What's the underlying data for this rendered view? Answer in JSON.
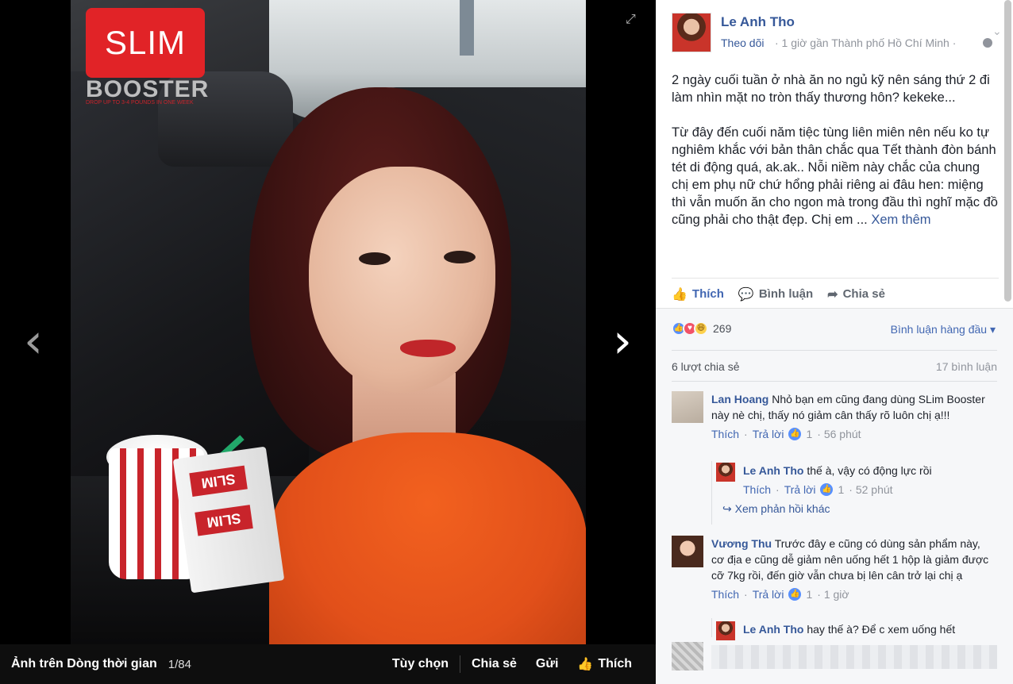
{
  "viewer": {
    "album_title": "Ảnh trên Dòng thời gian",
    "counter": "1/84",
    "options_label": "Tùy chọn",
    "share_label": "Chia sẻ",
    "send_label": "Gửi",
    "like_label": "Thích",
    "logo_text": "SLIM",
    "logo_sub": "BOOSTER",
    "logo_tagline": "DROP UP TO 3-4 POUNDS IN ONE WEEK"
  },
  "post": {
    "author": "Le Anh Tho",
    "follow": "Theo dõi",
    "meta": "· 1 giờ gần Thành phố Hồ Chí Minh ·",
    "paragraph1": "2 ngày cuối tuần ở nhà ăn no ngủ kỹ nên sáng thứ 2 đi làm nhìn mặt no tròn thấy thương hôn? kekeke...",
    "paragraph2": "Từ đây đến cuối năm tiệc tùng liên miên nên nếu ko tự nghiêm khắc với bản thân chắc qua Tết thành đòn bánh tét di động quá, ak.ak.. Nỗi niềm này chắc của chung chị em phụ nữ chứ hổng phải riêng ai đâu hen: miệng thì vẫn muốn ăn cho ngon mà trong đầu thì nghĩ mặc đồ cũng phải cho thật đẹp. Chị em ...",
    "see_more": "Xem thêm",
    "actions": {
      "like": "Thích",
      "comment": "Bình luận",
      "share": "Chia sẻ"
    }
  },
  "feedback": {
    "reaction_count": "269",
    "sort_label": "Bình luận hàng đầu",
    "shares": "6 lượt chia sẻ",
    "comments_total": "17 bình luận"
  },
  "comments": [
    {
      "author": "Lan Hoang",
      "text": "Nhỏ bạn em cũng đang dùng SLim Booster này nè chị, thấy nó giảm cân thấy rõ luôn chị ạ!!!",
      "like": "Thích",
      "reply": "Trả lời",
      "likes": "1",
      "time": "· 56 phút"
    },
    {
      "author": "Le Anh Tho",
      "text": "thế à, vậy có động lực rồi",
      "like": "Thích",
      "reply": "Trả lời",
      "likes": "1",
      "time": "· 52 phút"
    },
    {
      "author": "Vương Thu",
      "text": "Trước đây e cũng có dùng sản phẩm này, cơ địa e cũng dễ giảm nên uống hết 1 hộp là giảm được cỡ 7kg rồi, đến giờ vẫn chưa bị lên cân trở lại chị ạ",
      "like": "Thích",
      "reply": "Trả lời",
      "likes": "1",
      "time": "· 1 giờ"
    },
    {
      "author": "Le Anh Tho",
      "text": "hay thế à? Để c xem uống hết"
    }
  ],
  "more_replies": "Xem phản hồi khác",
  "colors": {
    "link": "#365899",
    "brand_red": "#e12327",
    "like_blue": "#4267b2"
  }
}
